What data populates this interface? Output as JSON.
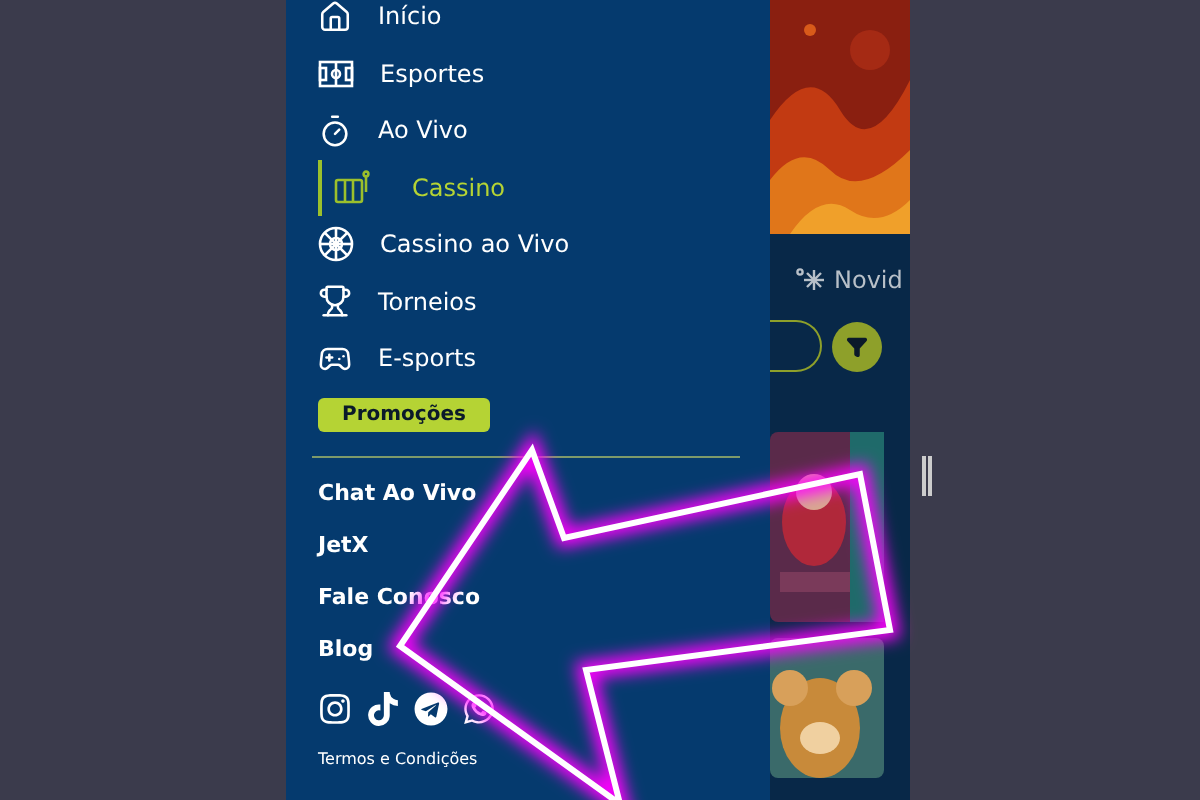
{
  "drawer": {
    "items": [
      {
        "label": "Início",
        "kind": "home",
        "selected": false
      },
      {
        "label": "Esportes",
        "kind": "field",
        "selected": false
      },
      {
        "label": "Ao Vivo",
        "kind": "timer",
        "selected": false
      },
      {
        "label": "Cassino",
        "kind": "slot",
        "selected": true
      },
      {
        "label": "Cassino ao Vivo",
        "kind": "roulette",
        "selected": false
      },
      {
        "label": "Torneios",
        "kind": "trophy",
        "selected": false
      },
      {
        "label": "E-sports",
        "kind": "gamepad",
        "selected": false
      }
    ],
    "promo_button": "Promoções",
    "links": [
      "Chat Ao Vivo",
      "JetX",
      "Fale Conosco",
      "Blog"
    ],
    "social": [
      {
        "kind": "instagram"
      },
      {
        "kind": "tiktok"
      },
      {
        "kind": "telegram"
      },
      {
        "kind": "whatsapp"
      }
    ],
    "terms": "Termos e Condições"
  },
  "background_app": {
    "tab": "Novid"
  }
}
